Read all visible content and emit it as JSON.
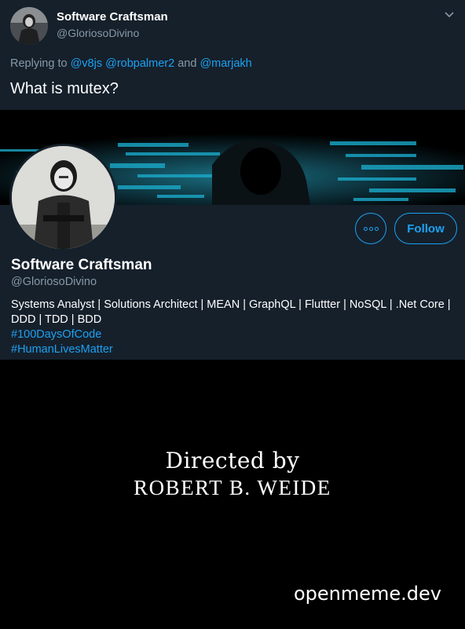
{
  "tweet": {
    "author_name": "Software Craftsman",
    "author_handle": "@GloriosoDivino",
    "replying_prefix": "Replying to ",
    "mentions": [
      "@v8js",
      "@robpalmer2",
      "@marjakh"
    ],
    "mention_sep": " ",
    "mention_and": " and ",
    "text": "What is mutex?"
  },
  "profile": {
    "name": "Software Craftsman",
    "handle": "@GloriosoDivino",
    "follow_label": "Follow",
    "bio": "Systems Analyst  | Solutions Architect | MEAN | GraphQL | Fluttter | NoSQL | .Net Core | DDD | TDD | BDD",
    "hashtags": [
      "#100DaysOfCode",
      "#HumanLivesMatter"
    ]
  },
  "credits": {
    "line1": "Directed by",
    "line2": "ROBERT B. WEIDE"
  },
  "watermark": "openmeme.dev",
  "colors": {
    "background": "#15202b",
    "accent": "#1da1f2",
    "muted": "#8899a6"
  }
}
